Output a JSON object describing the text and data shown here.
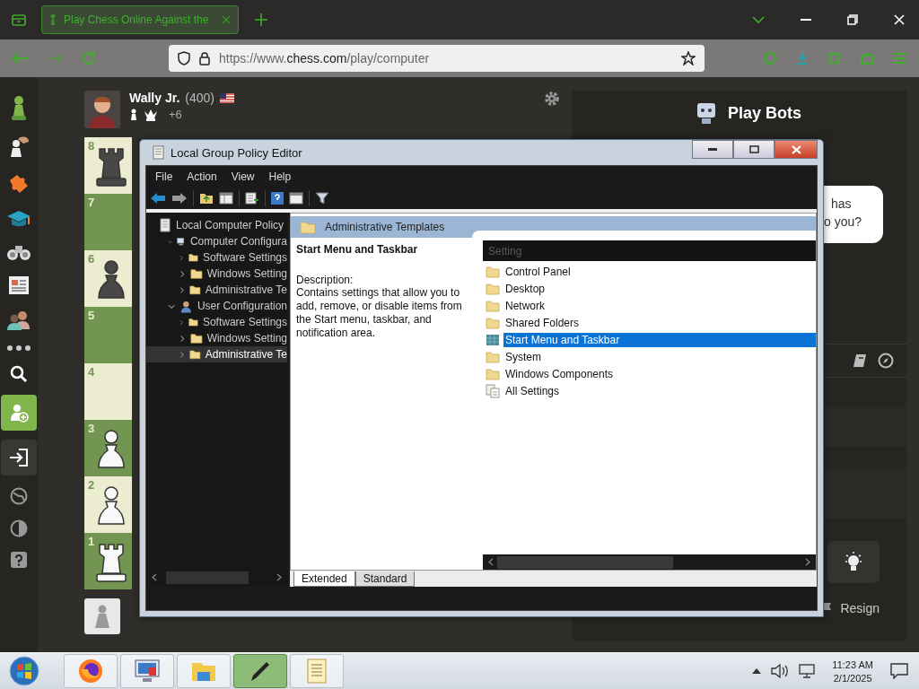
{
  "browser": {
    "tab": {
      "title": "Play Chess Online Against the",
      "selected": true
    },
    "url": {
      "prefix": "https://www.",
      "domain": "chess.com",
      "path": "/play/computer"
    }
  },
  "player": {
    "name": "Wally Jr.",
    "rating": "(400)",
    "advantage": "+6"
  },
  "board": [
    {
      "rank": "8",
      "color": "#ebecd0",
      "piece": {
        "kind": "rook",
        "color": "#4a4846"
      }
    },
    {
      "rank": "7",
      "color": "#739552"
    },
    {
      "rank": "6",
      "color": "#ebecd0",
      "piece": {
        "kind": "pawn",
        "color": "#4a4846"
      }
    },
    {
      "rank": "5",
      "color": "#739552"
    },
    {
      "rank": "4",
      "color": "#ebecd0"
    },
    {
      "rank": "3",
      "color": "#739552",
      "piece": {
        "kind": "pawn",
        "color": "#f8f8f8"
      }
    },
    {
      "rank": "2",
      "color": "#ebecd0",
      "piece": {
        "kind": "pawn",
        "color": "#f8f8f8"
      }
    },
    {
      "rank": "1",
      "color": "#739552",
      "piece": {
        "kind": "rook",
        "color": "#f8f8f8"
      }
    }
  ],
  "right_panel": {
    "title": "Play Bots",
    "chat_lines": [
      "has",
      "o you?"
    ],
    "resign": "Resign"
  },
  "gpe": {
    "title": "Local Group Policy Editor",
    "menu": [
      "File",
      "Action",
      "View",
      "Help"
    ],
    "tree": [
      {
        "label": "Local Computer Policy",
        "kind": "policy",
        "selected": false,
        "children": [
          {
            "label": "Computer Configura",
            "kind": "computer",
            "expanded": true,
            "selected": false,
            "children": [
              {
                "label": "Software Settings",
                "kind": "folder",
                "expanded": false,
                "selected": false
              },
              {
                "label": "Windows Setting",
                "kind": "folder",
                "expanded": false,
                "selected": false
              },
              {
                "label": "Administrative Te",
                "kind": "folder",
                "expanded": false,
                "selected": false
              }
            ]
          },
          {
            "label": "User Configuration",
            "kind": "user",
            "expanded": true,
            "selected": false,
            "children": [
              {
                "label": "Software Settings",
                "kind": "folder",
                "expanded": false,
                "selected": false
              },
              {
                "label": "Windows Setting",
                "kind": "folder",
                "expanded": false,
                "selected": false
              },
              {
                "label": "Administrative Te",
                "kind": "folder",
                "expanded": false,
                "selected": true
              }
            ]
          }
        ]
      }
    ],
    "header": "Administrative Templates",
    "description": {
      "title": "Start Menu and Taskbar",
      "label": "Description:",
      "text": "Contains settings that allow you to add, remove, or disable items from the Start menu, taskbar, and notification area."
    },
    "column": "Setting",
    "items": [
      {
        "label": "Control Panel",
        "kind": "folder",
        "selected": false
      },
      {
        "label": "Desktop",
        "kind": "folder",
        "selected": false
      },
      {
        "label": "Network",
        "kind": "folder",
        "selected": false
      },
      {
        "label": "Shared Folders",
        "kind": "folder",
        "selected": false
      },
      {
        "label": "Start Menu and Taskbar",
        "kind": "policy",
        "selected": true
      },
      {
        "label": "System",
        "kind": "folder",
        "selected": false
      },
      {
        "label": "Windows Components",
        "kind": "folder",
        "selected": false
      },
      {
        "label": "All Settings",
        "kind": "all",
        "selected": false
      }
    ],
    "tabs": [
      {
        "label": "Extended",
        "selected": true
      },
      {
        "label": "Standard",
        "selected": false
      }
    ]
  },
  "taskbar": {
    "time": "11:23 AM",
    "date": "2/1/2025",
    "apps": [
      {
        "kind": "firefox",
        "active": false
      },
      {
        "kind": "computer",
        "active": false
      },
      {
        "kind": "explorer",
        "active": false
      },
      {
        "kind": "pen",
        "active": true
      },
      {
        "kind": "notepad",
        "active": false
      }
    ]
  }
}
